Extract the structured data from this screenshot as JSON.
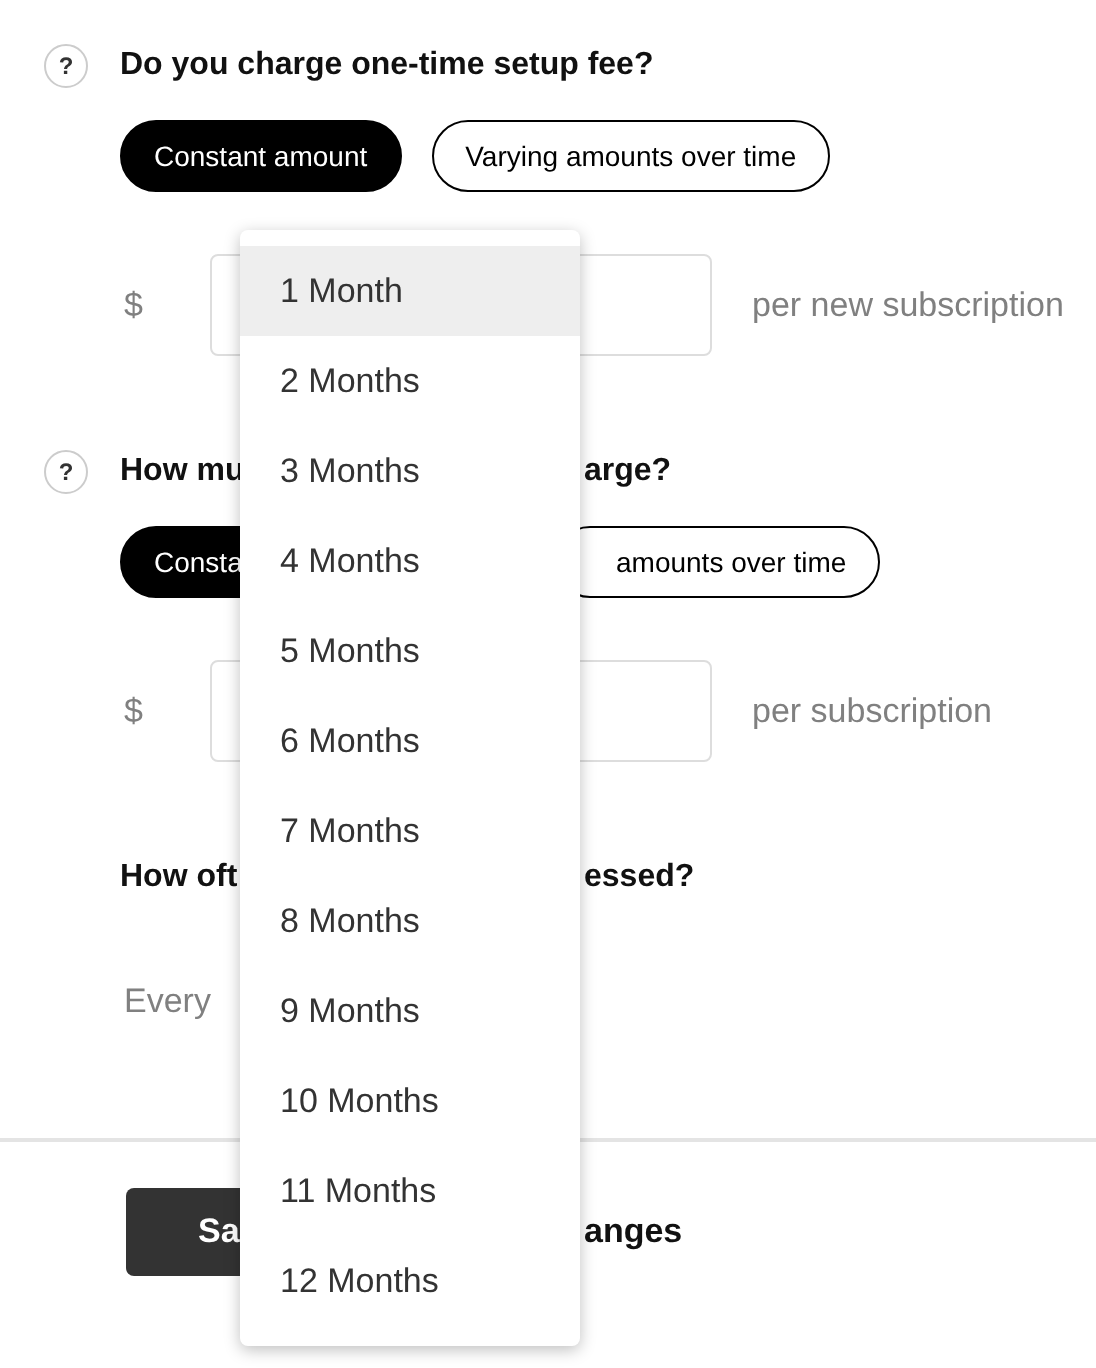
{
  "questions": [
    {
      "help": "?",
      "title": [
        "Do you charge one-time setup fee?"
      ],
      "options": [
        {
          "kind": "full",
          "label": "Constant amount",
          "selected": true
        },
        {
          "kind": "full",
          "label": "Varying amounts over time",
          "selected": false
        }
      ],
      "currency": "$",
      "suffix": "per new subscription"
    },
    {
      "help": "?",
      "title": [
        "How mu",
        "arge?"
      ],
      "options": [
        {
          "kind": "cut-right",
          "label": "Consta",
          "selected": true
        },
        {
          "kind": "cut-left",
          "label": "amounts over time",
          "selected": false
        }
      ],
      "currency": "$",
      "suffix": "per subscription"
    }
  ],
  "frequency": {
    "title": [
      "How oft",
      "essed?"
    ],
    "prefix": "Every"
  },
  "footer": {
    "save": "Sa",
    "other": "anges"
  },
  "menu": [
    {
      "label": "1 Month",
      "selected": true
    },
    {
      "label": "2 Months",
      "selected": false
    },
    {
      "label": "3 Months",
      "selected": false
    },
    {
      "label": "4 Months",
      "selected": false
    },
    {
      "label": "5 Months",
      "selected": false
    },
    {
      "label": "6 Months",
      "selected": false
    },
    {
      "label": "7 Months",
      "selected": false
    },
    {
      "label": "8 Months",
      "selected": false
    },
    {
      "label": "9 Months",
      "selected": false
    },
    {
      "label": "10 Months",
      "selected": false
    },
    {
      "label": "11 Months",
      "selected": false
    },
    {
      "label": "12 Months",
      "selected": false
    }
  ]
}
